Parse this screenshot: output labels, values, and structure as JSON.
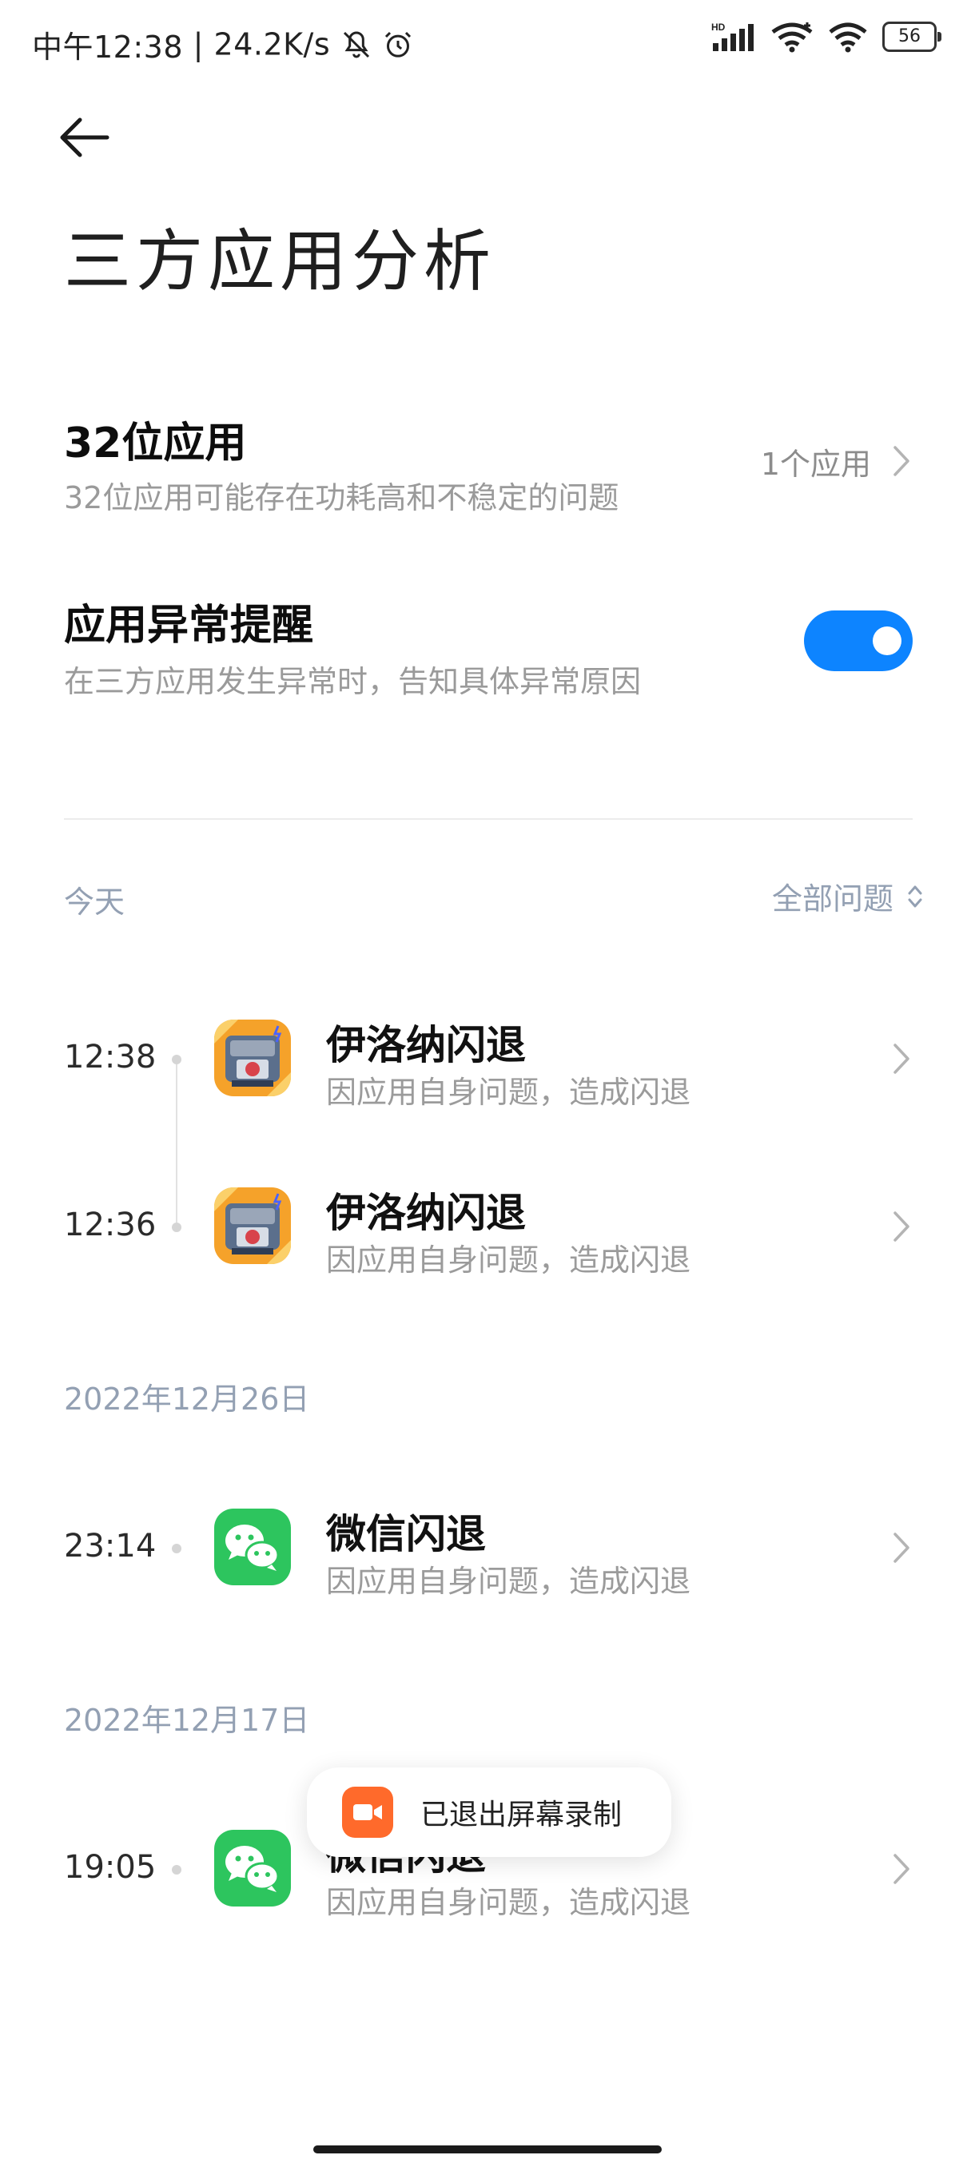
{
  "status_bar": {
    "time": "中午12:38",
    "separator": "|",
    "net_speed": "24.2K/s",
    "network_badge": "HD",
    "battery": "56",
    "icons": [
      "mute-icon",
      "alarm-icon",
      "cellular-signal-icon",
      "wifi-icon",
      "wifi-icon",
      "battery-icon"
    ]
  },
  "header": {
    "title": "三方应用分析"
  },
  "settings": {
    "apps_32bit": {
      "title": "32位应用",
      "subtitle": "32位应用可能存在功耗高和不稳定的问题",
      "value": "1个应用"
    },
    "anomaly_alert": {
      "title": "应用异常提醒",
      "subtitle": "在三方应用发生异常时，告知具体异常原因",
      "enabled": true,
      "accent": "#0d84ff"
    }
  },
  "filter": {
    "section": "今天",
    "label": "全部问题"
  },
  "groups": [
    {
      "date": "今天",
      "events": [
        {
          "time": "12:38",
          "app_icon": "iruna-app-icon",
          "title": "伊洛纳闪退",
          "subtitle": "因应用自身问题，造成闪退"
        },
        {
          "time": "12:36",
          "app_icon": "iruna-app-icon",
          "title": "伊洛纳闪退",
          "subtitle": "因应用自身问题，造成闪退"
        }
      ]
    },
    {
      "date": "2022年12月26日",
      "events": [
        {
          "time": "23:14",
          "app_icon": "wechat-app-icon",
          "title": "微信闪退",
          "subtitle": "因应用自身问题，造成闪退"
        }
      ]
    },
    {
      "date": "2022年12月17日",
      "events": [
        {
          "time": "19:05",
          "app_icon": "wechat-app-icon",
          "title": "微信闪退",
          "subtitle": "因应用自身问题，造成闪退"
        }
      ]
    }
  ],
  "toast": {
    "text": "已退出屏幕录制",
    "icon": "screen-record-icon",
    "color": "#ff6a2b"
  }
}
